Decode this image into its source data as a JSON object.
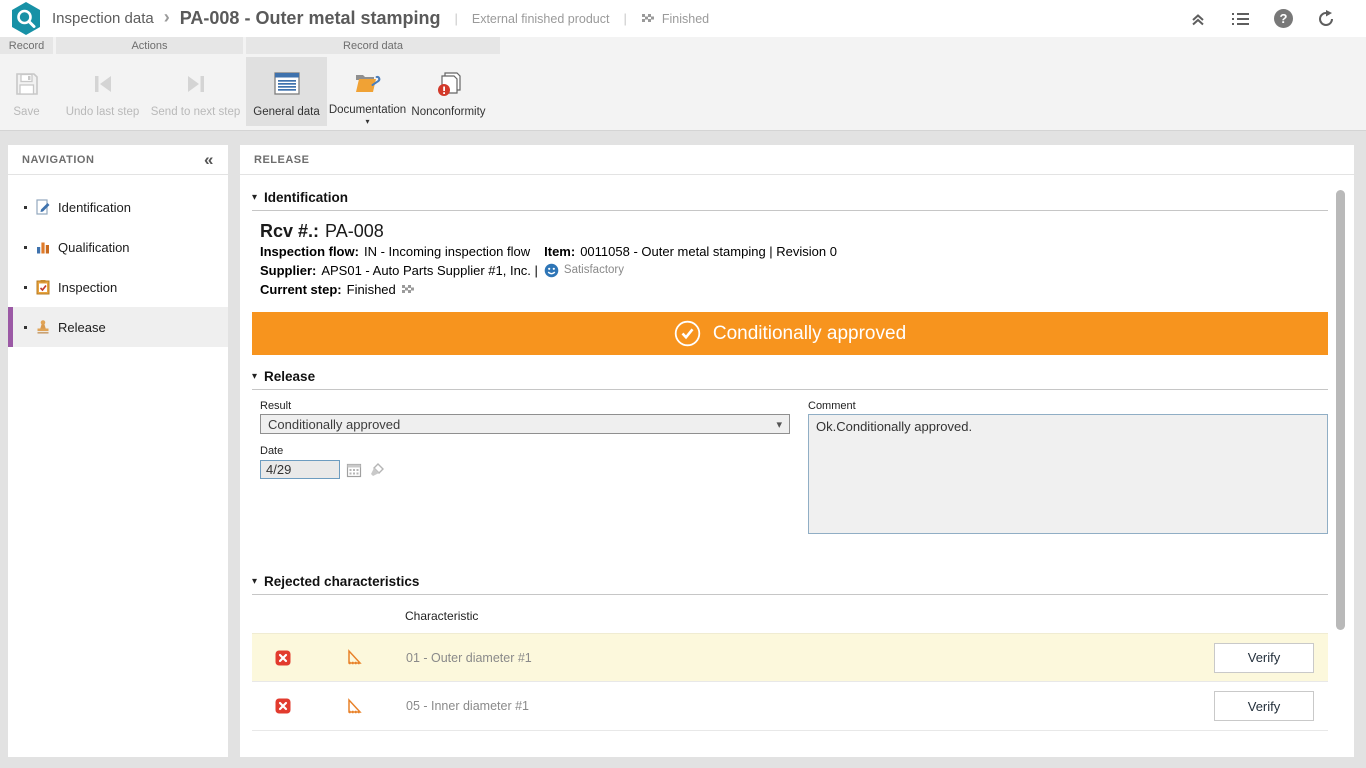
{
  "colors": {
    "brand_teal": "#1791A6",
    "accent_orange": "#F7941E",
    "selected_purple": "#9B59A5",
    "row_highlight_yellow": "#FCF8DC",
    "status_red": "#E23B2E",
    "icon_blue": "#3F72AD"
  },
  "glyphs": {
    "breadcrumb_chevron": "›",
    "divider": "|",
    "collapse_left": "«",
    "section_caret": "▾",
    "select_chevron": "▾",
    "dropdown_caret": "▾",
    "help": "?"
  },
  "header": {
    "app_breadcrumb": "Inspection data",
    "record_title": "PA-008 - Outer metal stamping",
    "product_type": "External finished product",
    "status": "Finished"
  },
  "ribbon": {
    "record": {
      "label": "Record",
      "save": "Save"
    },
    "actions": {
      "label": "Actions",
      "undo": "Undo last step",
      "send": "Send to next step"
    },
    "record_data": {
      "label": "Record data",
      "general": "General data",
      "documentation": "Documentation",
      "nonconformity": "Nonconformity"
    }
  },
  "nav": {
    "title": "NAVIGATION",
    "items": [
      {
        "label": "Identification"
      },
      {
        "label": "Qualification"
      },
      {
        "label": "Inspection"
      },
      {
        "label": "Release"
      }
    ]
  },
  "content": {
    "panel_title": "RELEASE",
    "identification": {
      "section_title": "Identification",
      "rcv_label": "Rcv #.:",
      "rcv_value": "PA-008",
      "inspection_flow_label": "Inspection flow:",
      "inspection_flow_value": "IN - Incoming inspection flow",
      "item_label": "Item:",
      "item_value": "0011058 - Outer metal stamping | Revision 0",
      "supplier_label": "Supplier:",
      "supplier_value": "APS01 - Auto Parts Supplier #1, Inc. |",
      "supplier_rating": "Satisfactory",
      "current_step_label": "Current step:",
      "current_step_value": "Finished"
    },
    "banner": {
      "text": "Conditionally approved"
    },
    "release": {
      "section_title": "Release",
      "result_label": "Result",
      "result_value": "Conditionally approved",
      "date_label": "Date",
      "date_value": "4/29",
      "comment_label": "Comment",
      "comment_value": "Ok.Conditionally approved."
    },
    "rejected": {
      "section_title": "Rejected characteristics",
      "column_header": "Characteristic",
      "rows": [
        {
          "characteristic": "01 - Outer diameter #1",
          "action": "Verify"
        },
        {
          "characteristic": "05 - Inner diameter #1",
          "action": "Verify"
        }
      ]
    }
  }
}
